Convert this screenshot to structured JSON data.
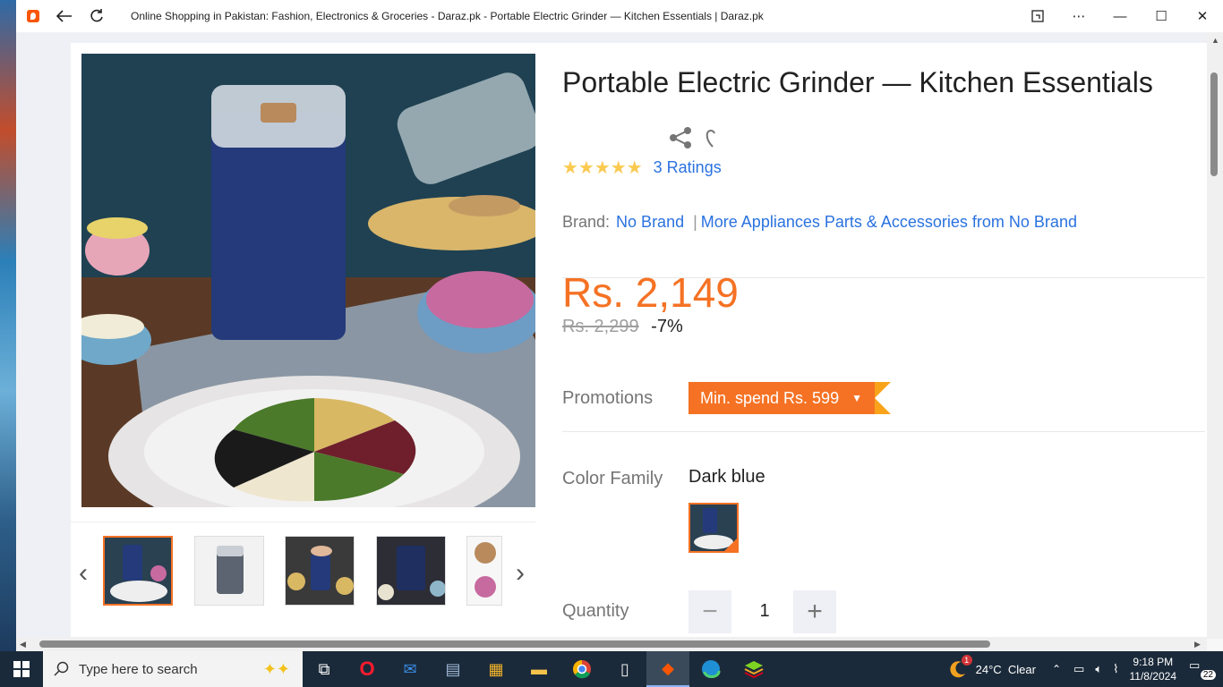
{
  "browser": {
    "title": "Online Shopping in Pakistan: Fashion, Electronics & Groceries - Daraz.pk - Portable Electric Grinder — Kitchen Essentials | Daraz.pk"
  },
  "product": {
    "title": "Portable Electric Grinder — Kitchen Essentials",
    "stars": "★★★★★",
    "ratings_label": "3 Ratings",
    "brand_label": "Brand:",
    "brand_name": "No Brand",
    "brand_separator": "|",
    "more_from_brand": "More Appliances Parts & Accessories from No Brand",
    "price": "Rs. 2,149",
    "original_price": "Rs. 2,299",
    "discount": "-7%",
    "promotions_label": "Promotions",
    "promotion_badge": "Min. spend Rs. 599",
    "color_family_label": "Color Family",
    "color_family_value": "Dark blue",
    "quantity_label": "Quantity",
    "quantity_value": "1",
    "quantity_minus": "−",
    "quantity_plus": "+"
  },
  "gallery": {
    "prev_arrow": "‹",
    "next_arrow": "›",
    "thumbnail_count": 5
  },
  "taskbar": {
    "search_placeholder": "Type here to search",
    "weather": "24°C  Clear",
    "weather_badge": "1",
    "time": "9:18 PM",
    "date": "11/8/2024",
    "notifications": "22"
  },
  "colors": {
    "accent": "#f57224",
    "link": "#2a72e0",
    "promo_tail": "#f9a31b",
    "star": "#faca51"
  }
}
